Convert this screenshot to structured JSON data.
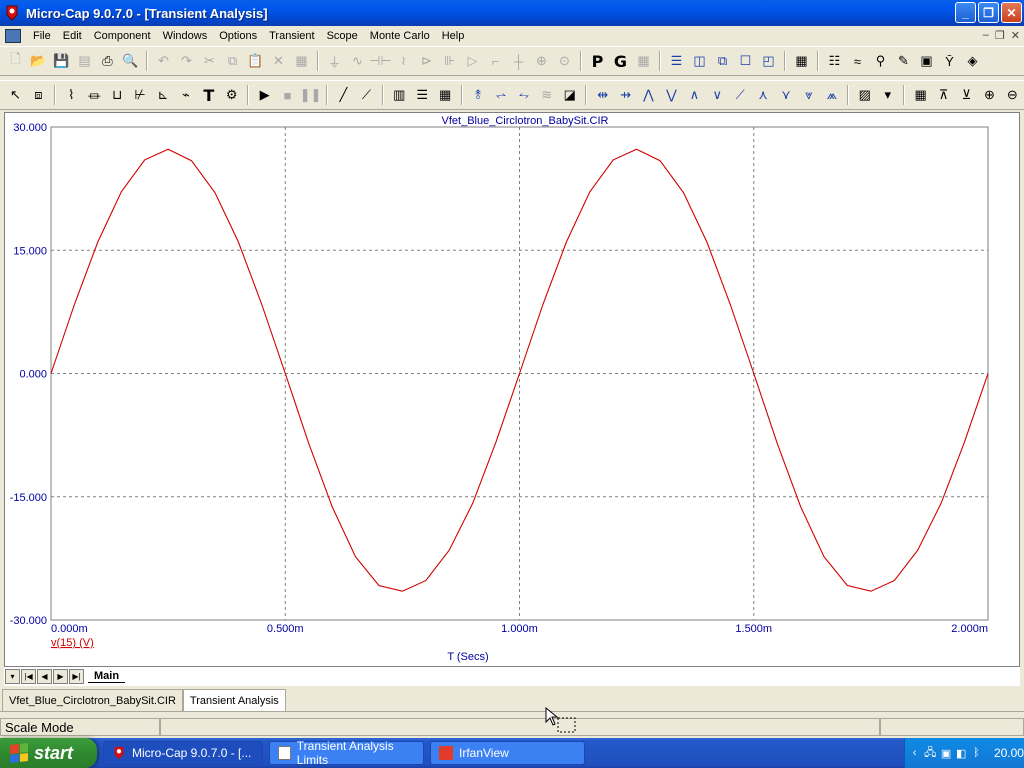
{
  "window": {
    "title": "Micro-Cap 9.0.7.0 - [Transient Analysis]",
    "controls": [
      "minimize",
      "restore",
      "close"
    ]
  },
  "menu": {
    "items": [
      "File",
      "Edit",
      "Component",
      "Windows",
      "Options",
      "Transient",
      "Scope",
      "Monte Carlo",
      "Help"
    ]
  },
  "toolbar1": {
    "text_buttons": [
      "P",
      "G"
    ]
  },
  "toolbar2": {
    "text_buttons": [
      "T"
    ]
  },
  "plot": {
    "title": "Vfet_Blue_Circlotron_BabySit.CIR",
    "xlabel": "T (Secs)",
    "trace_label": "v(15) (V)",
    "y_tick_labels": [
      "30.000",
      "15.000",
      "0.000",
      "-15.000",
      "-30.000"
    ],
    "x_tick_labels": [
      "0.000m",
      "0.500m",
      "1.000m",
      "1.500m",
      "2.000m"
    ],
    "colors": {
      "axis_text": "#0000a0",
      "trace": "#d00000",
      "grid": "#808080"
    }
  },
  "chart_data": {
    "type": "line",
    "title": "Vfet_Blue_Circlotron_BabySit.CIR",
    "xlabel": "T (Secs)",
    "ylabel": "",
    "xlim": [
      0,
      2.0
    ],
    "ylim": [
      -30,
      30
    ],
    "x_unit": "ms",
    "grid": true,
    "series": [
      {
        "name": "v(15) (V)",
        "x": [
          0.0,
          0.05,
          0.1,
          0.15,
          0.2,
          0.25,
          0.3,
          0.35,
          0.4,
          0.45,
          0.5,
          0.55,
          0.6,
          0.65,
          0.7,
          0.75,
          0.8,
          0.85,
          0.9,
          0.95,
          1.0,
          1.05,
          1.1,
          1.15,
          1.2,
          1.25,
          1.3,
          1.35,
          1.4,
          1.45,
          1.5,
          1.55,
          1.6,
          1.65,
          1.7,
          1.75,
          1.8,
          1.85,
          1.9,
          1.95,
          2.0
        ],
        "values": [
          0.0,
          8.4,
          16.0,
          22.1,
          26.0,
          27.3,
          25.9,
          22.0,
          16.0,
          8.4,
          0.0,
          -8.5,
          -16.2,
          -22.3,
          -25.8,
          -26.5,
          -25.2,
          -21.5,
          -15.8,
          -8.3,
          0.0,
          8.4,
          16.0,
          22.1,
          26.0,
          27.3,
          25.9,
          22.0,
          16.0,
          8.4,
          0.0,
          -8.5,
          -16.2,
          -22.3,
          -25.8,
          -26.5,
          -25.2,
          -21.5,
          -15.8,
          -8.3,
          0.0
        ]
      }
    ]
  },
  "sheet_tabs": {
    "active": "Main"
  },
  "doc_tabs": [
    "Vfet_Blue_Circlotron_BabySit.CIR",
    "Transient Analysis"
  ],
  "status": {
    "mode": "Scale Mode"
  },
  "taskbar": {
    "start_label": "start",
    "tasks": [
      "Micro-Cap 9.0.7.0 - [...",
      "Transient Analysis Limits",
      "IrfanView"
    ],
    "clock": "20.00"
  }
}
